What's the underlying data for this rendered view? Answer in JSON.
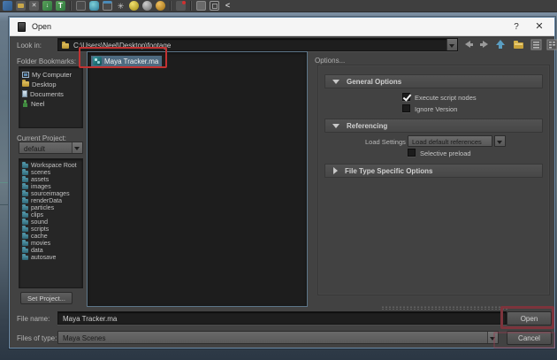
{
  "toolbar": {
    "icons": [
      {
        "name": "new-scene-icon",
        "cls": "tb-new"
      },
      {
        "name": "open-scene-icon",
        "cls": "tb-open"
      },
      {
        "name": "save-scene-icon",
        "cls": "tb-x"
      },
      {
        "name": "undo-icon",
        "cls": "tb-import"
      },
      {
        "name": "redo-icon",
        "cls": "tb-t"
      },
      {
        "name": "separator",
        "cls": "tb-sep"
      },
      {
        "name": "snap-to-grid-icon",
        "cls": "tb-cube"
      },
      {
        "name": "snap-to-curve-icon",
        "cls": "tb-teal"
      },
      {
        "name": "snap-to-point-icon",
        "cls": "tb-cube2"
      },
      {
        "name": "snap-to-projected-center-icon",
        "cls": "tb-snap"
      },
      {
        "name": "make-live-yellow-icon",
        "cls": "tb-ball-y"
      },
      {
        "name": "make-live-gray-icon",
        "cls": "tb-ball-g"
      },
      {
        "name": "make-live-orange-icon",
        "cls": "tb-ball-o"
      },
      {
        "name": "separator",
        "cls": "tb-sep"
      },
      {
        "name": "input-connections-icon",
        "cls": "tb-flag"
      },
      {
        "name": "separator",
        "cls": "tb-sep"
      },
      {
        "name": "construction-history-icon",
        "cls": "tb-cube3"
      },
      {
        "name": "open-render-view-icon",
        "cls": "tb-frame"
      },
      {
        "name": "share-icon",
        "cls": "tb-share"
      }
    ]
  },
  "dialog": {
    "title": "Open",
    "help_label": "?",
    "close_label": "✕",
    "look_in_label": "Look in:",
    "path_value": "C:\\Users\\Neel\\Desktop\\footage",
    "folder_bookmarks_label": "Folder Bookmarks:",
    "bookmarks": [
      {
        "label": "My Computer",
        "icon": "ico-computer",
        "name": "my-computer-icon"
      },
      {
        "label": "Desktop",
        "icon": "ico-folder",
        "name": "desktop-folder-icon"
      },
      {
        "label": "Documents",
        "icon": "ico-doc",
        "name": "documents-icon"
      },
      {
        "label": "Neel",
        "icon": "ico-user",
        "name": "user-icon"
      }
    ],
    "current_project_label": "Current Project:",
    "current_project_value": "default",
    "project_folders": [
      "Workspace Root",
      "scenes",
      "assets",
      "images",
      "sourceimages",
      "renderData",
      "particles",
      "clips",
      "sound",
      "scripts",
      "cache",
      "movies",
      "data",
      "autosave"
    ],
    "set_project_label": "Set Project...",
    "file_list": {
      "selected_file": "Maya Tracker.ma"
    },
    "options": {
      "label": "Options...",
      "general_options_title": "General Options",
      "execute_script_nodes_label": "Execute script nodes",
      "execute_script_nodes_checked": true,
      "ignore_version_label": "Ignore Version",
      "ignore_version_checked": false,
      "referencing_title": "Referencing",
      "load_settings_label": "Load Settings",
      "load_settings_value": "Load default references",
      "selective_preload_label": "Selective preload",
      "selective_preload_checked": false,
      "file_type_title": "File Type Specific Options"
    },
    "file_name_label": "File name:",
    "file_name_value": "Maya Tracker.ma",
    "files_of_type_label": "Files of type:",
    "files_of_type_value": "Maya Scenes",
    "open_label": "Open",
    "cancel_label": "Cancel"
  },
  "annotations": {
    "color": "#c23232",
    "open_box_color": "#7d343c"
  }
}
